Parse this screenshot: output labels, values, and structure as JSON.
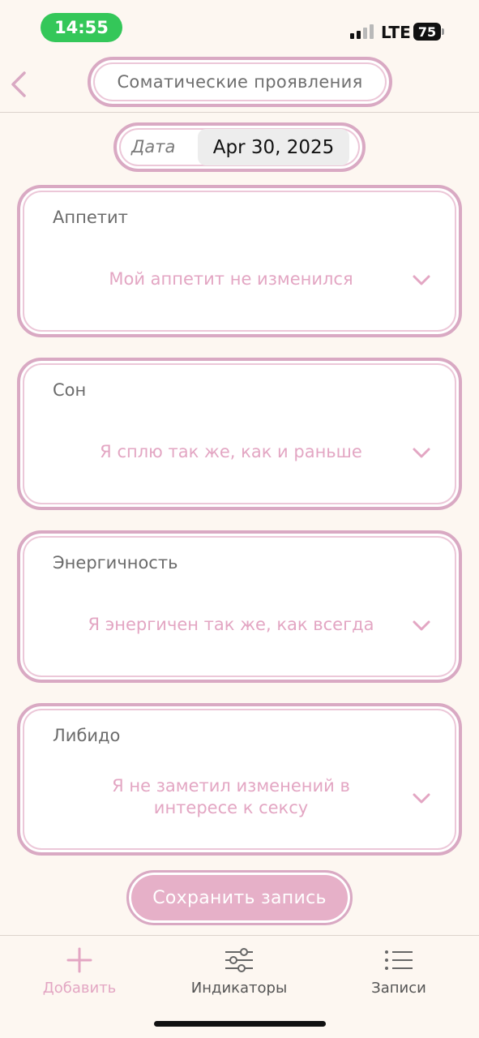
{
  "status_bar": {
    "time": "14:55",
    "network": "LTE",
    "battery": "75"
  },
  "header": {
    "title": "Соматические проявления",
    "back_icon": "chevron-left-icon"
  },
  "date": {
    "label": "Дата",
    "value": "Apr 30, 2025"
  },
  "cards": [
    {
      "title": "Аппетит",
      "value": "Мой аппетит не изменился"
    },
    {
      "title": "Сон",
      "value": "Я сплю так же, как и раньше"
    },
    {
      "title": "Энергичность",
      "value": "Я энергичен так же, как всегда"
    },
    {
      "title": "Либидо",
      "value": "Я не заметил изменений в интересе к сексу"
    }
  ],
  "save_button": {
    "label": "Сохранить запись"
  },
  "tabs": [
    {
      "label": "Добавить",
      "icon": "plus-icon",
      "active": true
    },
    {
      "label": "Индикаторы",
      "icon": "sliders-icon",
      "active": false
    },
    {
      "label": "Записи",
      "icon": "list-icon",
      "active": false
    }
  ],
  "colors": {
    "accent": "#d9a9c3",
    "value_text": "#e3a6c3",
    "active_tab": "#e3a6c3",
    "inactive_tab": "#555555",
    "background": "#fdf7f1"
  }
}
